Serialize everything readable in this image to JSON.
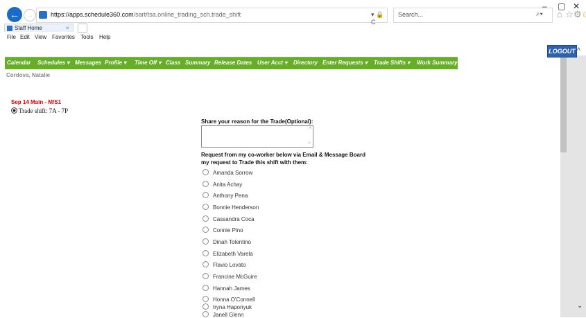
{
  "browser": {
    "url_host": "https://apps.schedule360.com",
    "url_path": "/sart/tsa.online_trading_sch.trade_shift",
    "addr_tools": "▾ 🔒 C",
    "search_placeholder": "Search...",
    "tab_title": "Staff Home",
    "tab_close": "×",
    "menu": [
      "File",
      "Edit",
      "View",
      "Favorites",
      "Tools",
      "Help"
    ]
  },
  "header": {
    "logout_label": "LOGOUT"
  },
  "nav": {
    "items": [
      "Calendar",
      "Schedules ▾",
      "Messages",
      "Profile ▾",
      "Time Off ▾",
      "Class",
      "Summary",
      "Release Dates",
      "User Acct ▾",
      "Directory",
      "Enter Requests ▾",
      "Trade Shifts ▾",
      "Work Summary"
    ]
  },
  "user": {
    "name": "Cordova, Natalie"
  },
  "shift": {
    "header": "Sep 14 Main - M/S1",
    "option": "Trade shift: 7A - 7P"
  },
  "form": {
    "reason_label": "Share your reason for the Trade(Optional):",
    "request_label_line1": "Request from my co-worker below via Email & Message Board",
    "request_label_line2": "my request to Trade this shift with them:",
    "coworkers": [
      "Amanda Sorrow",
      "Anita Achay",
      "Anthony Pena",
      "Bonnie Henderson",
      "Cassandra Coca",
      "Connie Pino",
      "Dinah Tolentino",
      "Elizabeth Varela",
      "Flavio Lovato",
      "Francine McGuire",
      "Hannah James",
      "Honna O'Connell",
      "Iryna Haponyuk",
      "Janell Glenn"
    ]
  }
}
